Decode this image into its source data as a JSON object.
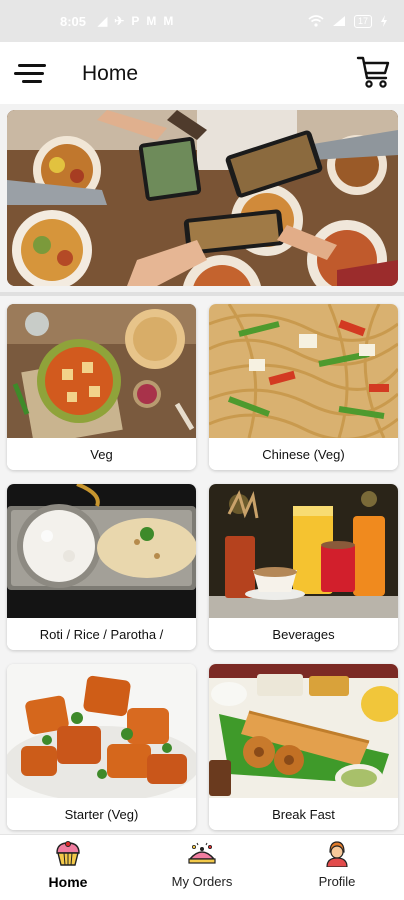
{
  "status_bar": {
    "time": "8:05",
    "notification_icons": [
      "◢",
      "✈",
      "P",
      "M",
      "M"
    ],
    "battery": "17"
  },
  "app_bar": {
    "title": "Home"
  },
  "categories": [
    {
      "label": "Veg"
    },
    {
      "label": "Chinese (Veg)"
    },
    {
      "label": "Roti / Rice / Parotha /"
    },
    {
      "label": "Beverages"
    },
    {
      "label": "Starter (Veg)"
    },
    {
      "label": "Break Fast"
    }
  ],
  "bottom_nav": {
    "items": [
      {
        "label": "Home",
        "icon": "cupcake-icon",
        "active": true
      },
      {
        "label": "My Orders",
        "icon": "orders-icon",
        "active": false
      },
      {
        "label": "Profile",
        "icon": "person-icon",
        "active": false
      }
    ]
  },
  "colors": {
    "background": "#f2f2f2",
    "card": "#ffffff",
    "text": "#111111"
  }
}
